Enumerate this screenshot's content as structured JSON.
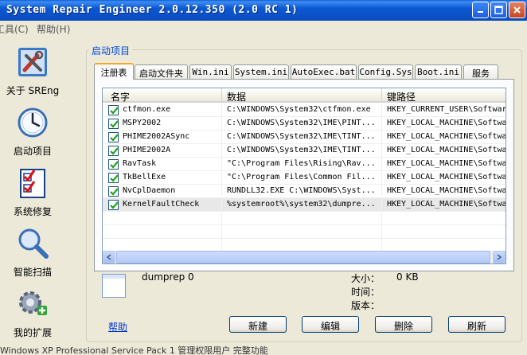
{
  "window": {
    "title": "System Repair Engineer 2.0.12.350 (2.0 RC 1)",
    "colors": {
      "titlebar": "#0a4fc6",
      "accent_tab": "#f5a623",
      "link": "#0033cc",
      "check": "#21a121"
    }
  },
  "menu": [
    {
      "label": "工具(C)"
    },
    {
      "label": "帮助(H)"
    }
  ],
  "nav": [
    {
      "label": "关于 SREng",
      "icon": "tools-icon"
    },
    {
      "label": "启动项目",
      "icon": "clock-icon"
    },
    {
      "label": "系统修复",
      "icon": "checklist-icon"
    },
    {
      "label": "智能扫描",
      "icon": "magnifier-icon"
    },
    {
      "label": "我的扩展",
      "icon": "gear-plus-icon"
    }
  ],
  "group_title": "启动项目",
  "tabs": [
    {
      "label": "注册表",
      "active": true
    },
    {
      "label": "启动文件夹",
      "active": false
    },
    {
      "label": "Win.ini",
      "active": false
    },
    {
      "label": "System.ini",
      "active": false
    },
    {
      "label": "AutoExec.bat",
      "active": false
    },
    {
      "label": "Config.Sys",
      "active": false
    },
    {
      "label": "Boot.ini",
      "active": false
    },
    {
      "label": "服务",
      "active": false
    }
  ],
  "list": {
    "columns": [
      "名字",
      "数据",
      "键路径"
    ],
    "rows": [
      {
        "checked": true,
        "name": "ctfmon.exe",
        "data": "C:\\WINDOWS\\System32\\ctfmon.exe",
        "path": "HKEY_CURRENT_USER\\Softwar"
      },
      {
        "checked": true,
        "name": "MSPY2002",
        "data": "C:\\WINDOWS\\System32\\IME\\PINT...",
        "path": "HKEY_LOCAL_MACHINE\\Softwa"
      },
      {
        "checked": true,
        "name": "PHIME2002ASync",
        "data": "C:\\WINDOWS\\System32\\IME\\TINT...",
        "path": "HKEY_LOCAL_MACHINE\\Softwa"
      },
      {
        "checked": true,
        "name": "PHIME2002A",
        "data": "C:\\WINDOWS\\System32\\IME\\TINT...",
        "path": "HKEY_LOCAL_MACHINE\\Softwa"
      },
      {
        "checked": true,
        "name": "RavTask",
        "data": "\"C:\\Program Files\\Rising\\Rav...",
        "path": "HKEY_LOCAL_MACHINE\\Softwa"
      },
      {
        "checked": true,
        "name": "TkBellExe",
        "data": "\"C:\\Program Files\\Common Fil...",
        "path": "HKEY_LOCAL_MACHINE\\Softwa"
      },
      {
        "checked": true,
        "name": "NvCplDaemon",
        "data": "RUNDLL32.EXE C:\\WINDOWS\\Syst...",
        "path": "HKEY_LOCAL_MACHINE\\Softwa"
      },
      {
        "checked": true,
        "name": "KernelFaultCheck",
        "data": "%systemroot%\\system32\\dumpre...",
        "path": "HKEY_LOCAL_MACHINE\\Softwa",
        "selected": true
      }
    ]
  },
  "detail": {
    "name": "dumprep 0",
    "size_label": "大小：",
    "size_value": "0 KB",
    "time_label": "时间：",
    "version_label": "版本："
  },
  "buttons": {
    "help": "帮助",
    "new": "新建",
    "edit": "编辑",
    "delete": "删除",
    "refresh": "刷新"
  },
  "statusbar": "Windows XP Professional Service Pack 1    管理权限用户    完整功能"
}
